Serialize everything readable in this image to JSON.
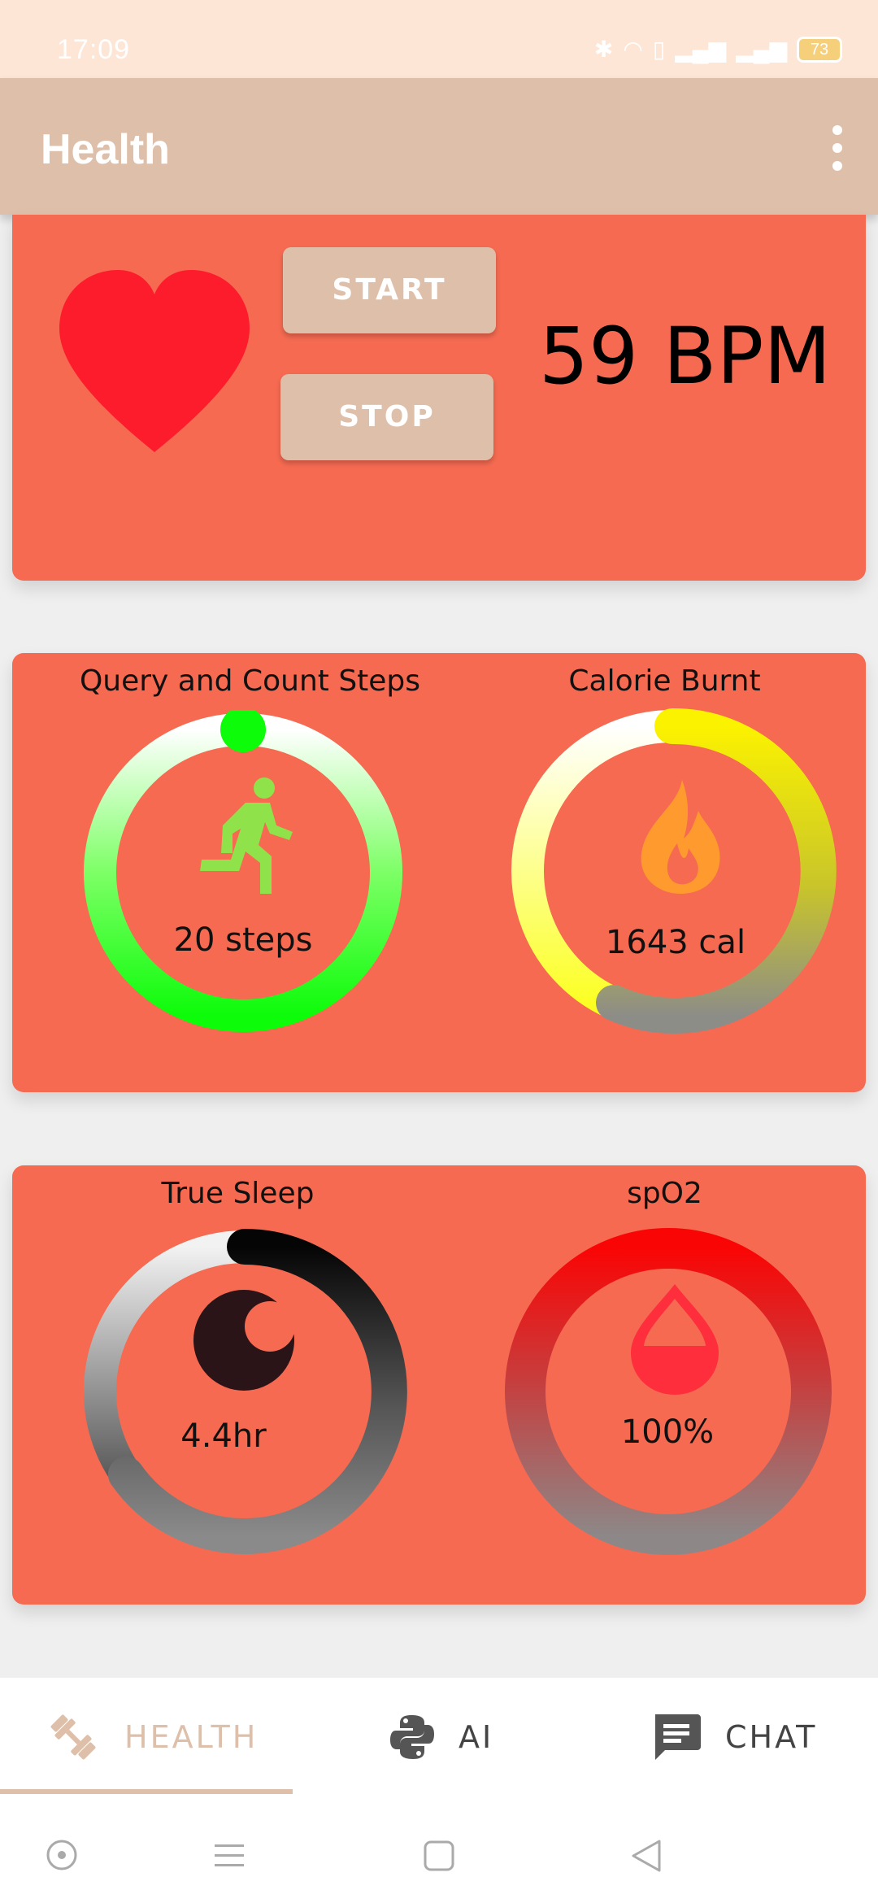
{
  "status": {
    "time": "17:09",
    "battery": "73"
  },
  "appbar": {
    "title": "Health"
  },
  "heart_rate": {
    "start_label": "START",
    "stop_label": "STOP",
    "bpm_text": "59 BPM"
  },
  "steps": {
    "label": "Query and Count Steps",
    "value_text": "20 steps"
  },
  "calories": {
    "label": "Calorie Burnt",
    "value_text": "1643 cal"
  },
  "sleep": {
    "label": "True Sleep",
    "value_text": "4.4hr"
  },
  "spo2": {
    "label": "spO2",
    "value_text": "100%"
  },
  "bottom_nav": {
    "health": "HEALTH",
    "ai": "AI",
    "chat": "CHAT"
  },
  "colors": {
    "card": "#f56a51",
    "accent": "#dec0aa",
    "heart": "#fc1c2c"
  },
  "icons": {
    "heart": "heart-icon",
    "runner": "runner-icon",
    "flame": "flame-icon",
    "moon": "moon-icon",
    "drop": "drop-icon",
    "dumbbell": "dumbbell-icon",
    "python": "python-icon",
    "chat": "chat-icon"
  }
}
